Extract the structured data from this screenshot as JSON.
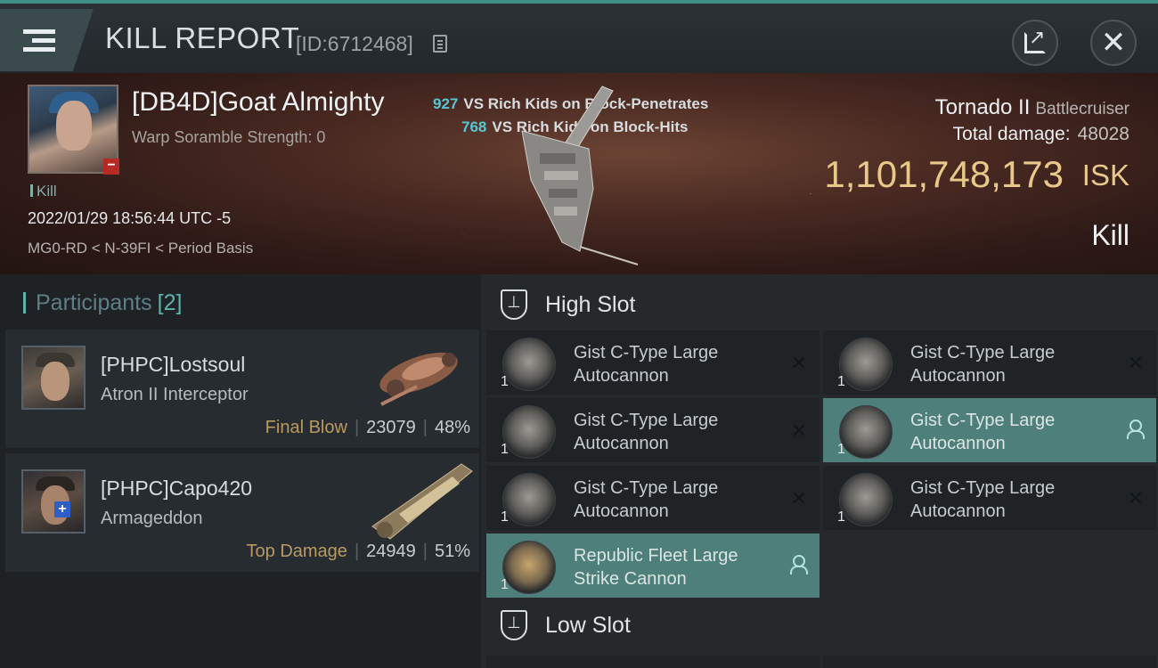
{
  "header": {
    "title": "KILL REPORT",
    "report_id": "[ID:6712468]"
  },
  "victim": {
    "name": "[DB4D]Goat Almighty",
    "warp_scramble": "Warp Soramble Strength: 0",
    "kill_tag": "Kill",
    "datetime": "2022/01/29 18:56:44 UTC -5",
    "location": "MG0-RD < N-39FI < Period Basis"
  },
  "versus": [
    {
      "num": "927",
      "text": "VS Rich Kids on Block-Penetrates"
    },
    {
      "num": "768",
      "text": "VS Rich Kids on Block-Hits"
    }
  ],
  "ship": {
    "name": "Tornado II",
    "class": "Battlecruiser",
    "total_damage_label": "Total damage:",
    "total_damage": "48028",
    "isk_value": "1,101,748,173",
    "isk_unit": "ISK",
    "result": "Kill"
  },
  "participants": {
    "title": "Participants",
    "count": "[2]",
    "items": [
      {
        "name": "[PHPC]Lostsoul",
        "ship": "Atron II Interceptor",
        "label": "Final Blow",
        "damage": "23079",
        "percent": "48%"
      },
      {
        "name": "[PHPC]Capo420",
        "ship": "Armageddon",
        "label": "Top Damage",
        "damage": "24949",
        "percent": "51%"
      }
    ]
  },
  "slots": {
    "high_label": "High Slot",
    "low_label": "Low Slot",
    "items": [
      {
        "qty": "1",
        "name": "Gist C-Type Large Autocannon",
        "state": "destroyed"
      },
      {
        "qty": "1",
        "name": "Gist C-Type Large Autocannon",
        "state": "destroyed"
      },
      {
        "qty": "1",
        "name": "Gist C-Type Large Autocannon",
        "state": "destroyed"
      },
      {
        "qty": "1",
        "name": "Gist C-Type Large Autocannon",
        "state": "dropped"
      },
      {
        "qty": "1",
        "name": "Gist C-Type Large Autocannon",
        "state": "destroyed"
      },
      {
        "qty": "1",
        "name": "Gist C-Type Large Autocannon",
        "state": "destroyed"
      },
      {
        "qty": "1",
        "name": "Republic Fleet Large Strike Cannon",
        "state": "dropped"
      }
    ]
  },
  "icons": {
    "close": "✕",
    "destroyed": "✕"
  },
  "colors": {
    "accent": "#5fb2ab",
    "isk": "#e8c98a",
    "final_blow": "#b99a61",
    "dropped_slot": "#4f7f7a",
    "vs_number": "#56c8d4"
  }
}
